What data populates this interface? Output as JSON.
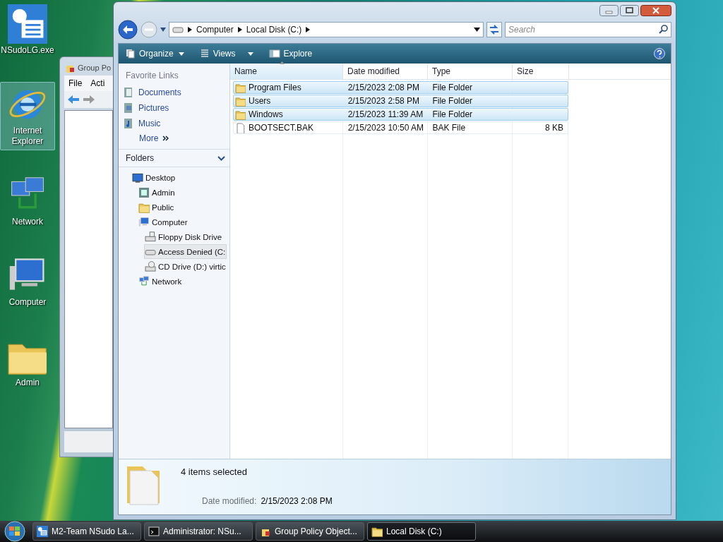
{
  "desktop_icons": [
    {
      "label": "NSudoLG.exe",
      "kind": "app",
      "selected": false
    },
    {
      "label": "Internet Explorer",
      "kind": "browser",
      "selected": true
    },
    {
      "label": "Network",
      "kind": "network",
      "selected": false
    },
    {
      "label": "Computer",
      "kind": "computer",
      "selected": false
    },
    {
      "label": "Admin",
      "kind": "folder",
      "selected": false
    }
  ],
  "background_window": {
    "title": "Group Po",
    "menu": [
      "File",
      "Acti"
    ]
  },
  "explorer": {
    "breadcrumb": [
      "Computer",
      "Local Disk (C:)"
    ],
    "search": {
      "placeholder": "Search"
    },
    "toolbar": [
      {
        "label": "Organize",
        "kind": "organize"
      },
      {
        "label": "Views",
        "kind": "views"
      },
      {
        "label": "Explore",
        "kind": "explore"
      }
    ],
    "favorite_links": {
      "heading": "Favorite Links",
      "items": [
        {
          "label": "Documents",
          "kind": "documents"
        },
        {
          "label": "Pictures",
          "kind": "pictures"
        },
        {
          "label": "Music",
          "kind": "music"
        }
      ],
      "more": "More"
    },
    "folders": {
      "heading": "Folders",
      "tree": [
        {
          "label": "Desktop",
          "kind": "desktop",
          "selected": false,
          "children": [
            {
              "label": "Admin",
              "kind": "user",
              "selected": false
            },
            {
              "label": "Public",
              "kind": "folder",
              "selected": false
            },
            {
              "label": "Computer",
              "kind": "computer",
              "selected": false,
              "children": [
                {
                  "label": "Floppy Disk Drive",
                  "kind": "floppy",
                  "selected": false
                },
                {
                  "label": "Access Denied (C:",
                  "kind": "drive",
                  "selected": true
                },
                {
                  "label": "CD Drive (D:) virtic",
                  "kind": "cd",
                  "selected": false
                }
              ]
            },
            {
              "label": "Network",
              "kind": "network",
              "selected": false
            }
          ]
        }
      ]
    },
    "columns": [
      {
        "label": "Name",
        "sorted": true
      },
      {
        "label": "Date modified",
        "sorted": false
      },
      {
        "label": "Type",
        "sorted": false
      },
      {
        "label": "Size",
        "sorted": false
      }
    ],
    "rows": [
      {
        "name": "Program Files",
        "kind": "folder",
        "date": "2/15/2023 2:08 PM",
        "type": "File Folder",
        "selected": true
      },
      {
        "name": "Users",
        "kind": "folder",
        "date": "2/15/2023 2:58 PM",
        "type": "File Folder",
        "selected": true
      },
      {
        "name": "Windows",
        "kind": "folder",
        "date": "2/15/2023 11:39 AM",
        "type": "File Folder",
        "selected": true
      },
      {
        "name": "BOOTSECT.BAK",
        "kind": "file",
        "date": "2/15/2023 10:50 AM",
        "type": "BAK File",
        "size": "8 KB",
        "selected": false
      }
    ],
    "details": {
      "summary": "4 items selected",
      "field_label": "Date modified:",
      "field_value": "2/15/2023 2:08 PM"
    }
  },
  "taskbar": {
    "buttons": [
      {
        "label": "M2-Team NSudo La...",
        "kind": "app",
        "selected": false
      },
      {
        "label": "Administrator: NSu...",
        "kind": "console",
        "selected": false
      },
      {
        "label": "Group Policy Object...",
        "kind": "policy",
        "selected": false
      },
      {
        "label": "Local Disk (C:)",
        "kind": "folder",
        "selected": true
      }
    ]
  }
}
